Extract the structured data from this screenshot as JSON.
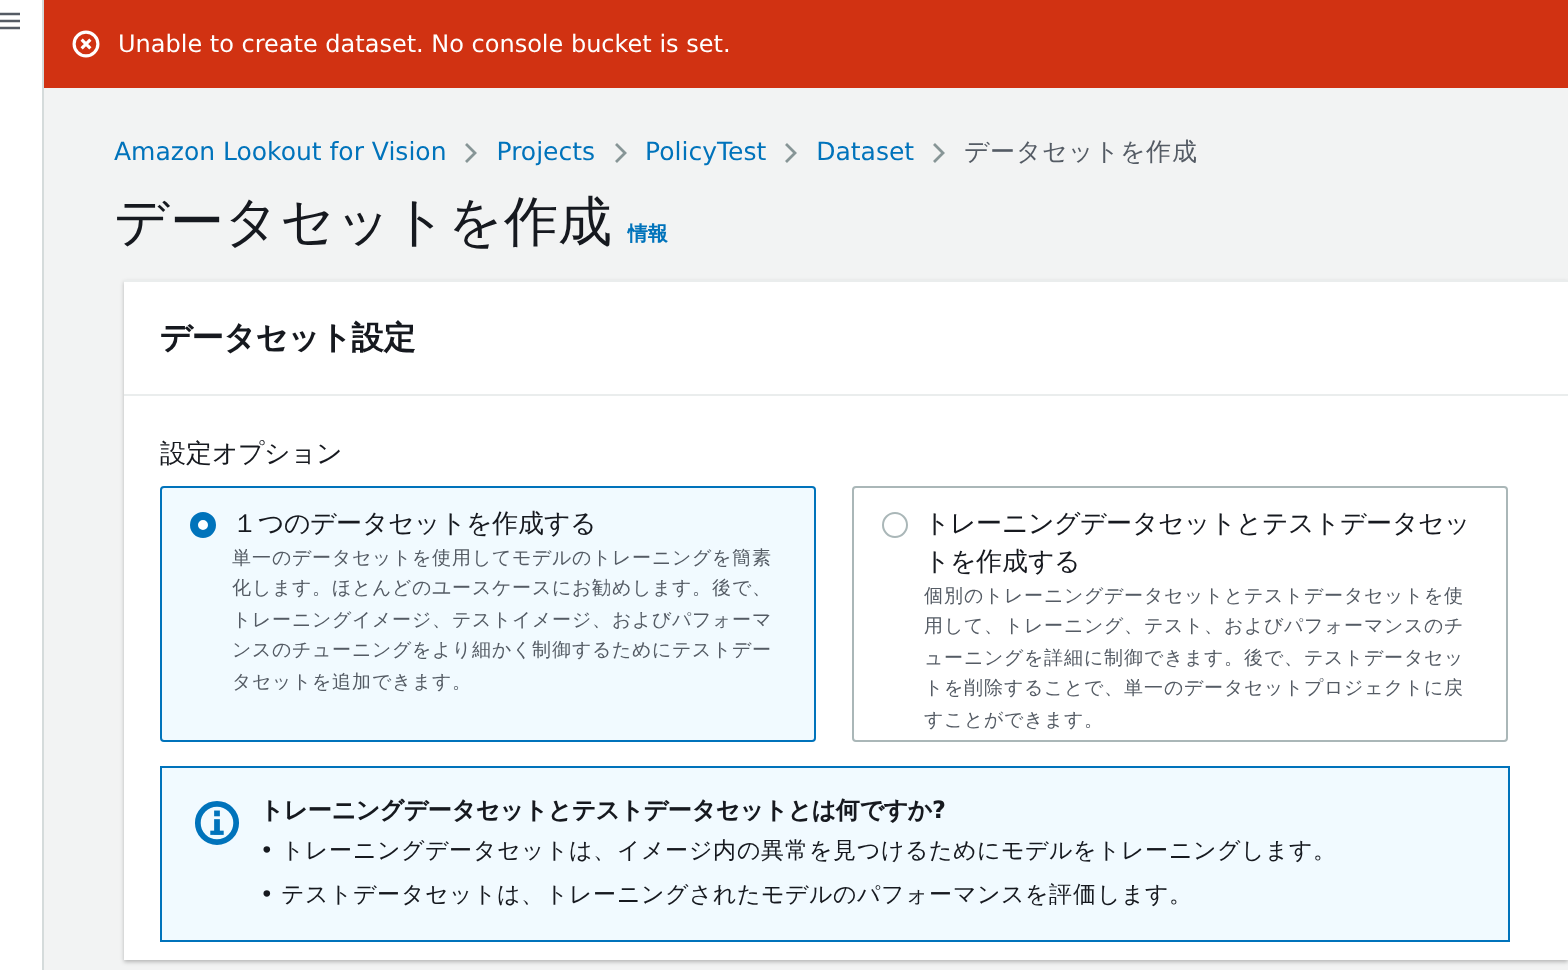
{
  "flash": {
    "kind": "error",
    "message": "Unable to create dataset. No console bucket is set."
  },
  "breadcrumbs": [
    {
      "label": "Amazon Lookout for Vision",
      "link": true
    },
    {
      "label": "Projects",
      "link": true
    },
    {
      "label": "PolicyTest",
      "link": true
    },
    {
      "label": "Dataset",
      "link": true
    },
    {
      "label": "データセットを作成",
      "link": false
    }
  ],
  "page": {
    "title": "データセットを作成",
    "info_link": "情報"
  },
  "card": {
    "title": "データセット設定",
    "field_label": "設定オプション",
    "options": [
      {
        "title": "１つのデータセットを作成する",
        "description": "単一のデータセットを使用してモデルのトレーニングを簡素化します。ほとんどのユースケースにお勧めします。後で、トレーニングイメージ、テストイメージ、およびパフォーマンスのチューニングをより細かく制御するためにテストデータセットを追加できます。",
        "selected": true
      },
      {
        "title": "トレーニングデータセットとテストデータセットを作成する",
        "description": "個別のトレーニングデータセットとテストデータセットを使用して、トレーニング、テスト、およびパフォーマンスのチューニングを詳細に制御できます。後で、テストデータセットを削除することで、単一のデータセットプロジェクトに戻すことができます。",
        "selected": false
      }
    ],
    "info": {
      "title": "トレーニングデータセットとテストデータセットとは何ですか?",
      "items": [
        "• トレーニングデータセットは、イメージ内の異常を見つけるためにモデルをトレーニングします。",
        "• テストデータセットは、トレーニングされたモデルのパフォーマンスを評価します。"
      ]
    }
  }
}
